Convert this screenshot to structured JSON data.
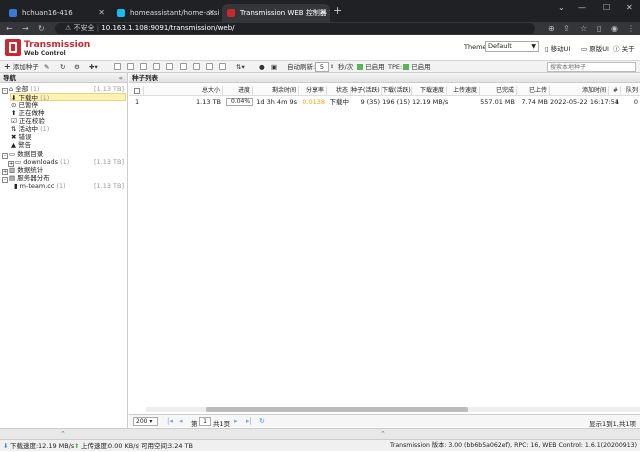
{
  "browser": {
    "tabs": [
      {
        "label": "hchuan16-416",
        "active": false
      },
      {
        "label": "homeassistant/home-assistan",
        "active": false
      },
      {
        "label": "Transmission WEB 控制器 1.6.1",
        "active": true
      }
    ],
    "new_tab": "+",
    "security_label": "不安全",
    "url": "10.163.1.108:9091/transmission/web/"
  },
  "header": {
    "logo_title": "Transmission",
    "logo_subtitle": "Web Control",
    "theme_label": "Theme:",
    "theme_value": "Default",
    "links": [
      "移动UI",
      "原版UI",
      "关于"
    ]
  },
  "toolbar": {
    "add_torrent": "添加种子",
    "auto_refresh_label": "自动刷新:",
    "auto_refresh_value": "5",
    "auto_refresh_unit": "秒/次",
    "enabled1": "已启用",
    "tpe_label": "TPE:",
    "enabled2": "已启用",
    "search_placeholder": "搜索本地种子"
  },
  "nav": {
    "title": "导航",
    "items": [
      {
        "label": "全部",
        "count": "(1)",
        "size": "[1.13 TB]"
      },
      {
        "label": "下载中",
        "count": "(1)"
      },
      {
        "label": "已暂停"
      },
      {
        "label": "正在做种"
      },
      {
        "label": "正在校验"
      },
      {
        "label": "活动中",
        "count": "(1)"
      },
      {
        "label": "错误"
      },
      {
        "label": "警告"
      },
      {
        "label": "数据目录"
      },
      {
        "label": "downloads",
        "count": "(1)",
        "size": "[1.13 TB]"
      },
      {
        "label": "数据统计"
      },
      {
        "label": "服务器分布"
      },
      {
        "label": "m-team.cc",
        "count": "(1)",
        "size": "[1.13 TB]"
      }
    ]
  },
  "main": {
    "title": "种子列表",
    "columns": [
      "总大小",
      "进度",
      "剩余时间",
      "分享率",
      "状态",
      "种子(活跃)",
      "下载(活跃)",
      "下载速度",
      "上传速度",
      "已完成",
      "已上传",
      "添加时间",
      "#",
      "队列"
    ],
    "row": {
      "index": "1",
      "size": "1.13 TB",
      "progress": "0.04%",
      "remaining": "1d 3h 4m 9s",
      "ratio": "0.0138",
      "status": "下载中",
      "seeds": "9 (35)",
      "peers": "196 (15)",
      "down_speed": "12.19 MB/s",
      "up_speed": "",
      "completed": "557.01 MB",
      "uploaded": "7.74 MB",
      "added": "2022-05-22 16:17:54",
      "id": "1",
      "queue": "0"
    }
  },
  "pager": {
    "page_size": "200",
    "page_label": "第",
    "page_value": "1",
    "total_pages": "共1页",
    "summary": "显示1到1,共1项"
  },
  "status": {
    "down_label": "下载速度:",
    "down_value": "12.19 MB/s",
    "up_label": "上传速度:",
    "up_value": "0.00 KB/s",
    "free_label": "可用空间:",
    "free_value": "3.24 TB",
    "version": "Transmission 版本: 3.00 (bb6b5a062ef), RPC: 16, WEB Control: 1.6.1(20200913)"
  },
  "colors": {
    "brand": "#c8282e",
    "selected": "#fff3b4",
    "ratio": "#e6a100"
  }
}
